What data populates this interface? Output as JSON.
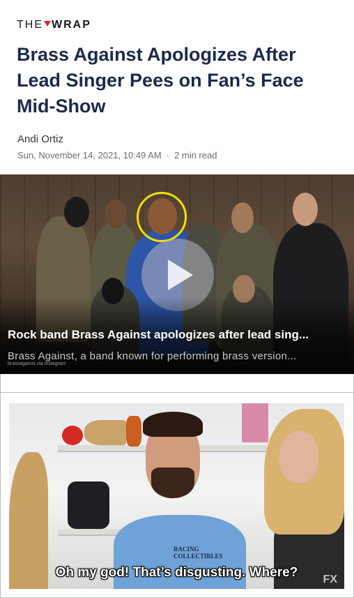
{
  "publication": {
    "logo_the": "THE",
    "logo_wrap": "WRAP"
  },
  "article": {
    "headline": "Brass Against Apologizes After Lead Singer Pees on Fan’s Face Mid-Show",
    "author": "Andi Ortiz",
    "date": "Sun, November 14, 2021, 10:49 AM",
    "separator": "·",
    "read_time": "2 min read"
  },
  "video": {
    "title": "Rock band Brass Against apologizes after lead sing...",
    "description": "Brass Against, a band known for performing brass version...",
    "credit": "brassagainst via Instagram",
    "play_icon": "play-icon"
  },
  "gif": {
    "caption": "Oh my god! That’s disgusting. Where?",
    "shirt_text": "RACING COLLECTIBLES",
    "watermark": "FX"
  },
  "colors": {
    "headline": "#1c2a4a",
    "logo_accent": "#d9262a",
    "highlight_ring": "#f5e000"
  }
}
